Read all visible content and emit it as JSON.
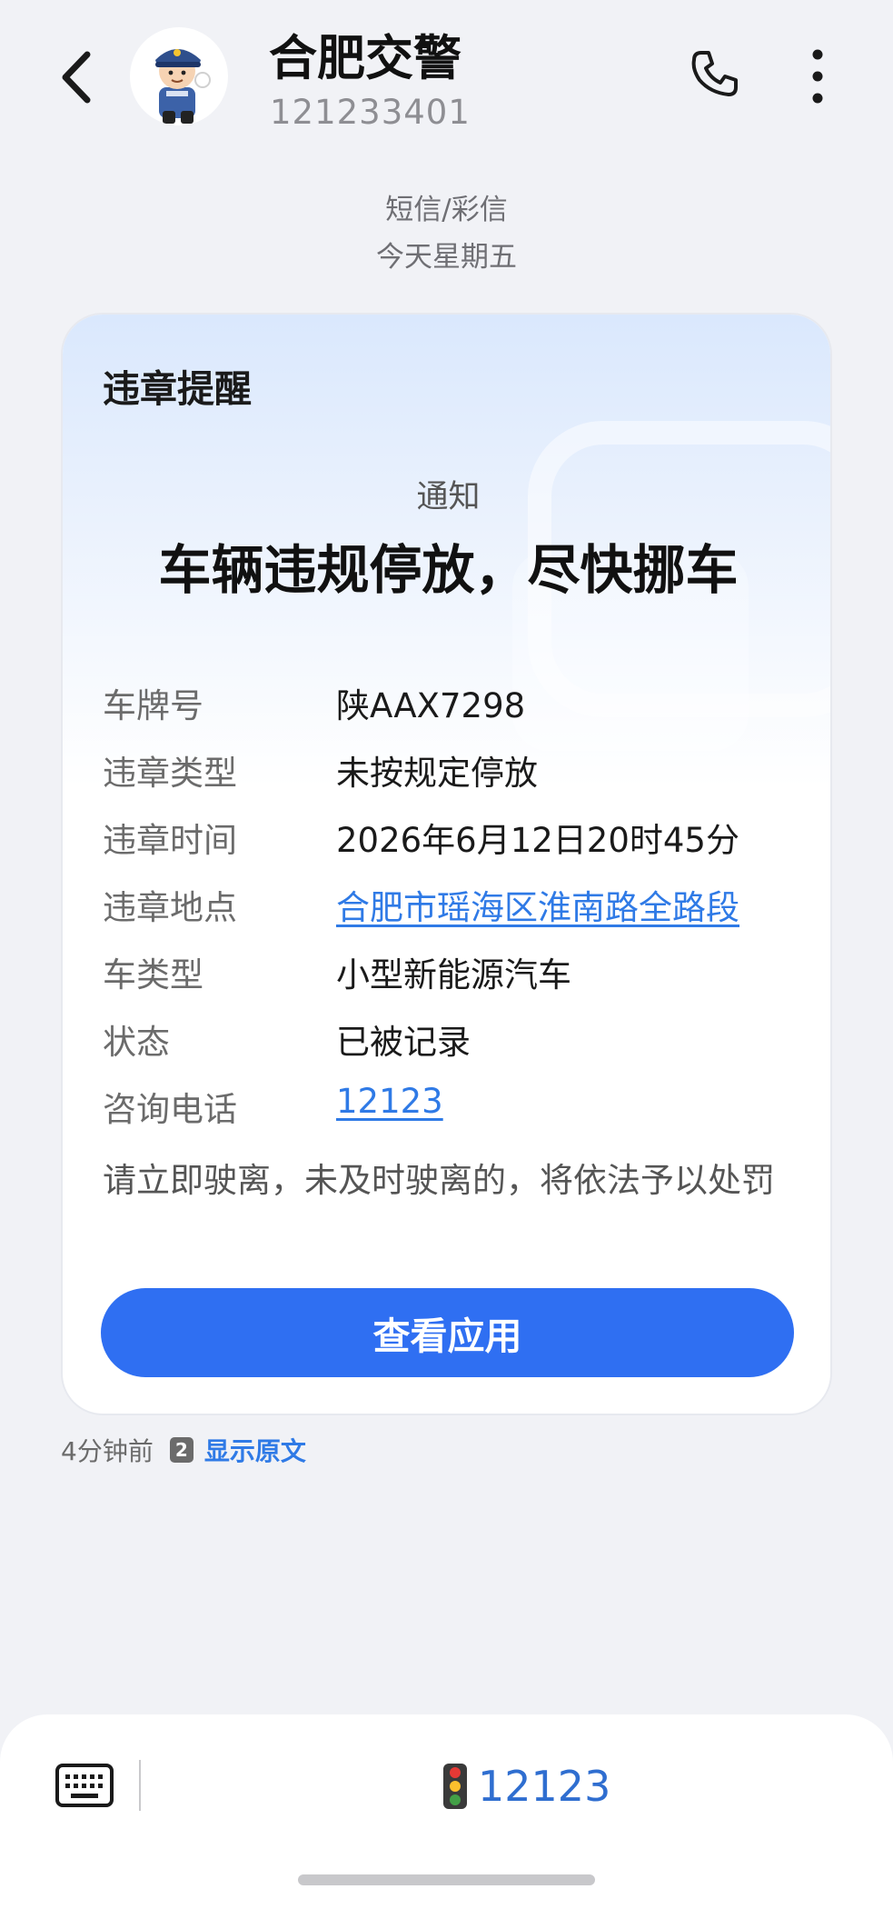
{
  "header": {
    "contact_name": "合肥交警",
    "contact_number": "121233401"
  },
  "thread": {
    "message_type": "短信/彩信",
    "date_label": "今天星期五"
  },
  "card": {
    "title": "违章提醒",
    "notice_label": "通知",
    "headline": "车辆违规停放，尽快挪车",
    "rows": [
      {
        "label": "车牌号",
        "value": "陕AAX7298"
      },
      {
        "label": "违章类型",
        "value": "未按规定停放"
      },
      {
        "label": "违章时间",
        "value": "2026年6月12日20时45分"
      },
      {
        "label": "违章地点",
        "value": "合肥市瑶海区淮南路全路段"
      },
      {
        "label": "车类型",
        "value": "小型新能源汽车"
      },
      {
        "label": "状态",
        "value": "已被记录"
      },
      {
        "label": "咨询电话",
        "value": "12123"
      }
    ],
    "warning": "请立即驶离，未及时驶离的，将依法予以处罚",
    "button_label": "查看应用"
  },
  "meta": {
    "time_ago": "4分钟前",
    "sim_slot": "2",
    "show_original": "显示原文"
  },
  "bottom_bar": {
    "quick_reply": "12123"
  },
  "colors": {
    "accent": "#2f6ff2",
    "link": "#2f7ae6",
    "background": "#f1f2f6"
  },
  "icons": {
    "back": "chevron-left-icon",
    "call": "phone-icon",
    "more": "more-vertical-icon",
    "keyboard": "keyboard-icon",
    "traffic_light": "traffic-light-icon"
  }
}
